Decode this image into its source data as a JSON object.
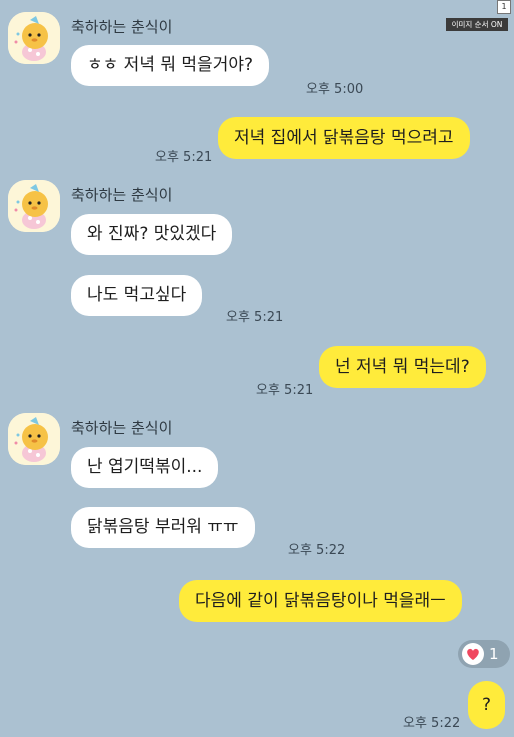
{
  "header": {
    "page_number": "1",
    "image_order_label": "이미지 순서 ON"
  },
  "sender_name": "축하하는 춘식이",
  "messages": {
    "m1": {
      "text": "ㅎㅎ 저녁 뭐 먹을거야?",
      "time": "오후 5:00"
    },
    "m2": {
      "text": "저녁 집에서 닭볶음탕 먹으려고",
      "time": "오후 5:21"
    },
    "m3": {
      "text": "와 진짜? 맛있겠다"
    },
    "m4": {
      "text": "나도 먹고싶다",
      "time": "오후 5:21"
    },
    "m5": {
      "text": "넌 저녁 뭐 먹는데?",
      "time": "오후 5:21"
    },
    "m6": {
      "text": "난 엽기떡볶이..."
    },
    "m7": {
      "text": "닭볶음탕 부러워 ㅠㅠ",
      "time": "오후 5:22"
    },
    "m8": {
      "text": "다음에 같이 닭볶음탕이나 먹을래ㅡ"
    },
    "m9": {
      "text": "?",
      "time": "오후 5:22"
    }
  },
  "reaction": {
    "icon": "heart-icon",
    "count": "1",
    "color": "#f0475f"
  },
  "colors": {
    "background": "#abc1d1",
    "outgoing": "#ffeb3b",
    "incoming": "#ffffff"
  }
}
